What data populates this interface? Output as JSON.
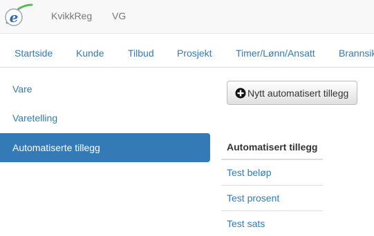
{
  "header": {
    "app_name": "KvikkReg",
    "user": "VG"
  },
  "mainnav": {
    "items": [
      "Startside",
      "Kunde",
      "Tilbud",
      "Prosjekt",
      "Timer/Lønn/Ansatt",
      "Brannsik"
    ]
  },
  "sidebar": {
    "items": [
      {
        "label": "Vare",
        "active": false
      },
      {
        "label": "Varetelling",
        "active": false
      },
      {
        "label": "Automatiserte tillegg",
        "active": true
      }
    ]
  },
  "toolbar": {
    "add_label": "Nytt automatisert tillegg",
    "add_icon": "plus-circle-icon"
  },
  "table": {
    "header": "Automatisert tillegg",
    "rows": [
      "Test beløp",
      "Test prosent",
      "Test sats"
    ]
  },
  "colors": {
    "link": "#337ab7",
    "active_bg": "#337ab7",
    "logo_blue": "#2f6db5",
    "logo_green": "#5cb85c"
  }
}
